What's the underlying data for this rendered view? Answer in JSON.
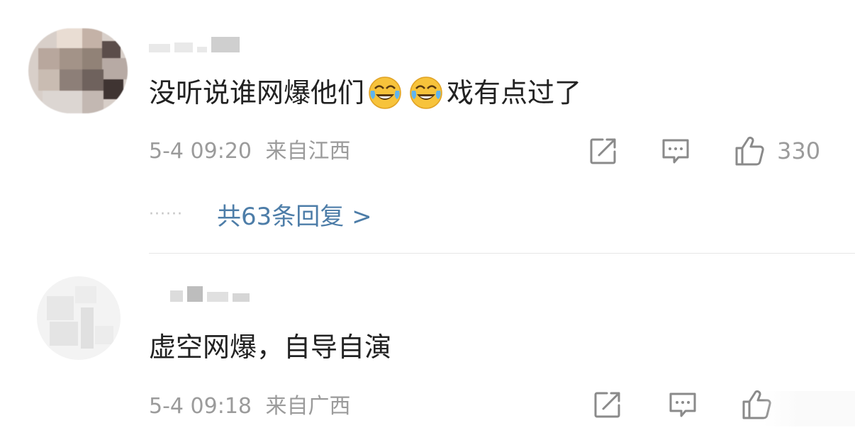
{
  "comments": [
    {
      "username": "",
      "content_text": "没听说谁网爆他们",
      "content_tail": "戏有点过了",
      "emojis": [
        "crying-laughing-emoji",
        "crying-laughing-emoji"
      ],
      "timestamp": "5-4 09:20",
      "location": "来自江西",
      "like_count": "330",
      "reply_summary": "共63条回复 >",
      "reply_dots": "······"
    },
    {
      "username": "",
      "content_text": "虚空网爆，自导自演",
      "timestamp": "5-4 09:18",
      "location": "来自广西",
      "like_count": "",
      "like_count_obscured": true
    }
  ],
  "icons": {
    "share": "share-icon",
    "comment": "comment-icon",
    "like": "thumbs-up-icon"
  },
  "colors": {
    "text": "#222222",
    "meta": "#9b9b9b",
    "link": "#4d7da8",
    "divider": "#e6e6e6",
    "emoji_face": "#f7c33b"
  }
}
